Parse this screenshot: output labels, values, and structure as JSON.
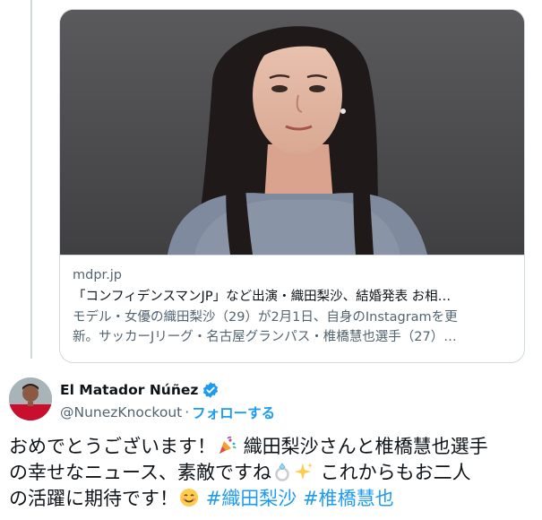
{
  "link_card": {
    "domain": "mdpr.jp",
    "title": "「コンフィデンスマンJP」など出演・織田梨沙、結婚発表 お相…",
    "description_line1": "モデル・女優の織田梨沙（29）が2月1日、自身のInstagramを更",
    "description_line2": "新。サッカーJリーグ・名古屋グランパス・椎橋慧也選手（27）…"
  },
  "tweet": {
    "author": {
      "display_name": "El Matador Núñez",
      "handle": "@NunezKnockout",
      "separator": "·",
      "follow_label": "フォローする",
      "verified": true
    },
    "text": {
      "line1_a": "おめでとうございます！",
      "line1_b": " 織田梨沙さんと椎橋慧也選手",
      "line2_a": "の幸せなニュース、素敵ですね",
      "line2_b": " これからもお二人",
      "line3_a": "の活躍に期待です！",
      "hashtag1": "#織田梨沙",
      "hashtag2": "#椎橋慧也"
    },
    "emojis": [
      "party-popper-icon",
      "ring-icon",
      "sparkles-icon",
      "smiling-face-icon"
    ]
  },
  "colors": {
    "link_blue": "#1d9bf0",
    "secondary_text": "#536471",
    "border": "#cfd9de",
    "verified_blue": "#1d9bf0"
  }
}
